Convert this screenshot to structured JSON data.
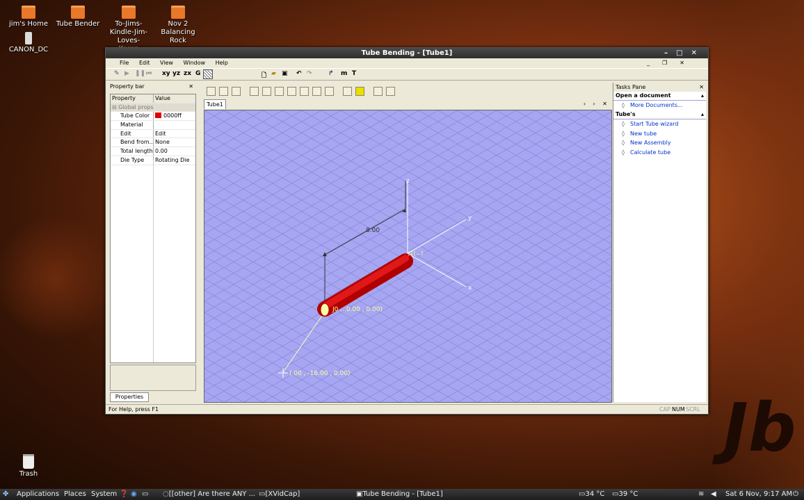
{
  "desktop": {
    "icons": [
      "jim's Home",
      "Tube Bender",
      "To-Jims-Kindle-Jim-Loves-Karen",
      "Nov 2 Balancing Rock",
      "CANON_DC",
      "Trash"
    ]
  },
  "window": {
    "title": "Tube Bending - [Tube1]",
    "controls": [
      "–",
      "□",
      "✕"
    ],
    "menu": [
      "File",
      "Edit",
      "View",
      "Window",
      "Help"
    ],
    "mdi_controls": [
      "_",
      "❐",
      "✕"
    ],
    "toolbar_text": [
      "xy",
      "yz",
      "zx",
      "G",
      "m",
      "T"
    ],
    "property_bar": {
      "title": "Property bar",
      "columns": [
        "Property",
        "Value"
      ],
      "group": "Global props",
      "rows": [
        {
          "name": "Tube Color",
          "value": "0000ff"
        },
        {
          "name": "Material",
          "value": ""
        },
        {
          "name": "Edit",
          "value": "Edit"
        },
        {
          "name": "Bend from...",
          "value": "None"
        },
        {
          "name": "Total length",
          "value": "0.00"
        },
        {
          "name": "Die Type",
          "value": "Rotating Die"
        }
      ],
      "tab": "Properties"
    },
    "document_tab": "Tube1",
    "tab_controls": "‹ › ✕",
    "viewport": {
      "dimension_label": "8.00",
      "axis_labels": [
        "z",
        "y",
        "x"
      ],
      "point_label_start": "J0 ...0.00 , 0.00)",
      "point_label_end": "(.00 , -16.00 , 0.00)",
      "end_label": "J1(...)",
      "tube_color": "#cc0000",
      "grid_color": "#8a8ad8",
      "background": "#a6a6f2"
    },
    "tasks_pane": {
      "title": "Tasks Pane",
      "sections": [
        {
          "title": "Open a document",
          "links": [
            "More Documents..."
          ]
        },
        {
          "title": "Tube's",
          "links": [
            "Start Tube wizard",
            "New tube",
            "New Assembly",
            "Calculate tube"
          ]
        }
      ]
    },
    "status": {
      "help": "For Help, press F1",
      "indicators": [
        "CAP",
        "NUM",
        "SCRL"
      ]
    }
  },
  "taskbar": {
    "menus": [
      "Applications",
      "Places",
      "System"
    ],
    "windows": [
      "[[other] Are there ANY ...",
      "[XVidCap]",
      "Tube Bending - [Tube1]"
    ],
    "temps": [
      "34 °C",
      "39 °C"
    ],
    "clock": "Sat 6 Nov,  9:17 AM"
  }
}
